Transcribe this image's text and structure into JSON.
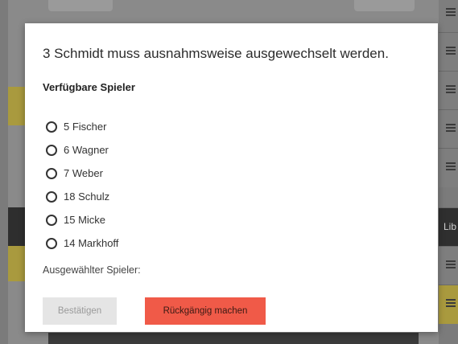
{
  "modal": {
    "message": "3 Schmidt muss ausnahmsweise ausgewechselt werden.",
    "available_heading": "Verfügbare Spieler",
    "players": [
      {
        "label": "5 Fischer"
      },
      {
        "label": "6 Wagner"
      },
      {
        "label": "7 Weber"
      },
      {
        "label": "18 Schulz"
      },
      {
        "label": "15 Micke"
      },
      {
        "label": "14 Markhoff"
      }
    ],
    "selected_player_label": "Ausgewählter Spieler:",
    "confirm_button": "Bestätigen",
    "undo_button": "Rückgängig machen"
  },
  "background": {
    "row_text": "Lib"
  },
  "colors": {
    "accent_red": "#f05a48",
    "disabled_gray": "#e5e5e5",
    "highlight_yellow": "#a99a3e"
  },
  "icons": [
    "radio-button-icon",
    "menu-icon"
  ]
}
